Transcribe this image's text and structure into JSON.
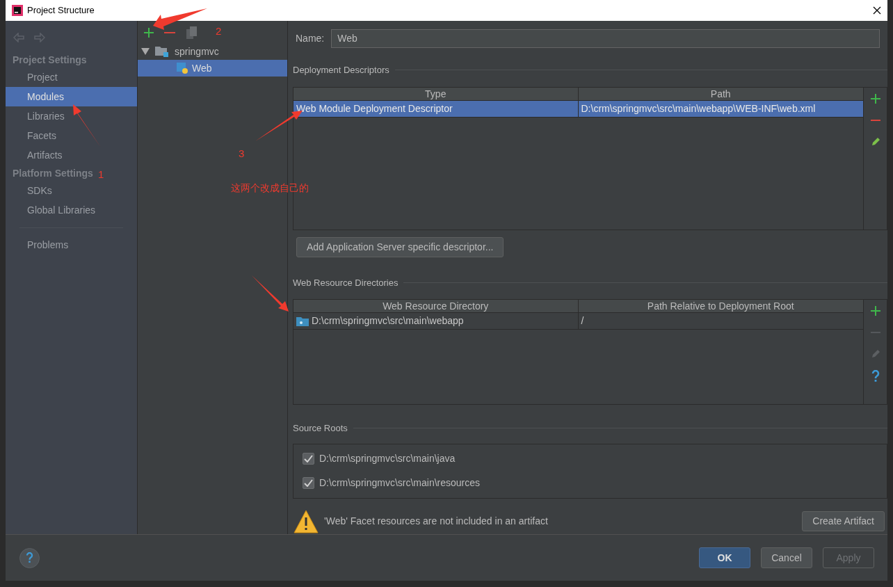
{
  "window": {
    "title": "Project Structure"
  },
  "sidebar": {
    "sections": [
      {
        "heading": "Project Settings",
        "items": [
          {
            "label": "Project",
            "selected": false
          },
          {
            "label": "Modules",
            "selected": true
          },
          {
            "label": "Libraries",
            "selected": false
          },
          {
            "label": "Facets",
            "selected": false
          },
          {
            "label": "Artifacts",
            "selected": false
          }
        ]
      },
      {
        "heading": "Platform Settings",
        "items": [
          {
            "label": "SDKs",
            "selected": false
          },
          {
            "label": "Global Libraries",
            "selected": false
          }
        ]
      }
    ],
    "footer_items": [
      {
        "label": "Problems",
        "selected": false
      }
    ]
  },
  "tree": {
    "items": [
      {
        "label": "springmvc",
        "expanded": true,
        "selected": false,
        "children": [
          {
            "label": "Web",
            "selected": true
          }
        ]
      }
    ]
  },
  "name_field": {
    "label": "Name:",
    "value": "Web"
  },
  "deployment_descriptors": {
    "title": "Deployment Descriptors",
    "columns": [
      "Type",
      "Path"
    ],
    "rows": [
      {
        "cells": [
          "Web Module Deployment Descriptor",
          "D:\\crm\\springmvc\\src\\main\\webapp\\WEB-INF\\web.xml"
        ],
        "selected": true
      }
    ],
    "toolbar": [
      {
        "kind": "add",
        "disabled": false
      },
      {
        "kind": "remove",
        "disabled": false
      },
      {
        "kind": "edit",
        "disabled": false
      }
    ],
    "button": "Add Application Server specific descriptor..."
  },
  "web_resource_directories": {
    "title": "Web Resource Directories",
    "columns": [
      "Web Resource Directory",
      "Path Relative to Deployment Root"
    ],
    "rows": [
      {
        "cells": [
          "D:\\crm\\springmvc\\src\\main\\webapp",
          "/"
        ],
        "selected": false
      }
    ],
    "toolbar": [
      {
        "kind": "add",
        "disabled": false
      },
      {
        "kind": "remove",
        "disabled": true
      },
      {
        "kind": "edit",
        "disabled": true
      },
      {
        "kind": "help",
        "disabled": false
      }
    ]
  },
  "source_roots": {
    "title": "Source Roots",
    "items": [
      {
        "path": "D:\\crm\\springmvc\\src\\main\\java",
        "checked": true
      },
      {
        "path": "D:\\crm\\springmvc\\src\\main\\resources",
        "checked": true
      }
    ]
  },
  "warning": {
    "text": "'Web' Facet resources are not included in an artifact",
    "button": "Create Artifact"
  },
  "buttons": [
    {
      "label": "OK",
      "primary": true,
      "disabled": false
    },
    {
      "label": "Cancel",
      "primary": false,
      "disabled": false
    },
    {
      "label": "Apply",
      "primary": false,
      "disabled": true
    }
  ],
  "annotations": [
    {
      "text": "1"
    },
    {
      "text": "2"
    },
    {
      "text": "3"
    },
    {
      "text": "这两个改成自己的"
    }
  ]
}
